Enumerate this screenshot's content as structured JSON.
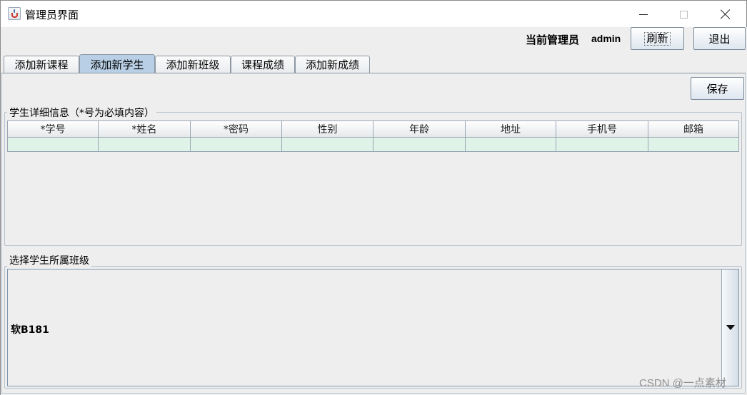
{
  "window": {
    "title": "管理员界面",
    "minimize_icon": "minimize-icon",
    "maximize_icon": "maximize-icon",
    "close_icon": "close-icon"
  },
  "header": {
    "admin_label": "当前管理员",
    "admin_name": "admin",
    "refresh_label": "刷新",
    "logout_label": "退出"
  },
  "tabs": [
    {
      "label": "添加新课程",
      "active": false
    },
    {
      "label": "添加新学生",
      "active": true
    },
    {
      "label": "添加新班级",
      "active": false
    },
    {
      "label": "课程成绩",
      "active": false
    },
    {
      "label": "添加新成绩",
      "active": false
    }
  ],
  "toolbar": {
    "save_label": "保存"
  },
  "student_detail": {
    "title": "学生详细信息（*号为必填内容）",
    "columns": [
      "*学号",
      "*姓名",
      "*密码",
      "性别",
      "年龄",
      "地址",
      "手机号",
      "邮箱"
    ],
    "row": [
      "",
      "",
      "",
      "",
      "",
      "",
      "",
      ""
    ],
    "row_color": "#dff3e8"
  },
  "class_select": {
    "title": "选择学生所属班级",
    "selected": "软B181"
  },
  "watermark": "CSDN @一点素材"
}
